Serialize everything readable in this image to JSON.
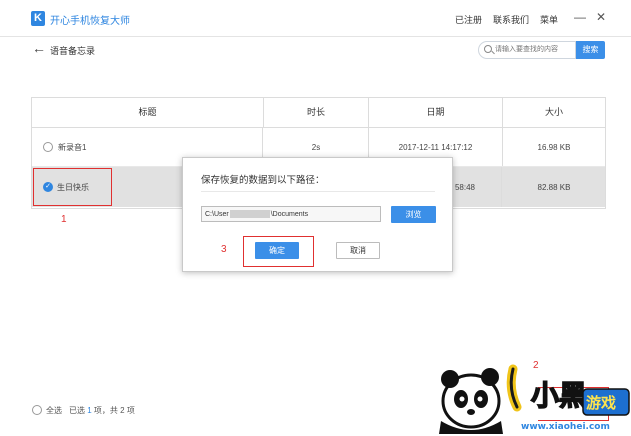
{
  "app": {
    "logo_letter": "K",
    "title": "开心手机恢复大师",
    "links": [
      "已注册",
      "联系我们",
      "菜单"
    ],
    "window_controls": [
      "—",
      "✕"
    ]
  },
  "nav": {
    "title": "语音备忘录",
    "search_placeholder": "请输入要查找的内容",
    "search_label": "搜索"
  },
  "table": {
    "headers": [
      "标题",
      "时长",
      "日期",
      "大小"
    ],
    "rows": [
      {
        "title": "新录音1",
        "duration": "2s",
        "date": "2017-12-11 14:17:12",
        "size": "16.98 KB",
        "checked": false
      },
      {
        "title": "生日快乐",
        "duration": "",
        "date": "58:48",
        "size": "82.88 KB",
        "checked": true
      }
    ]
  },
  "dialog": {
    "title": "保存恢复的数据到以下路径：",
    "path_prefix": "C:\\User",
    "path_suffix": "\\Documents",
    "browse_label": "浏览",
    "ok_label": "确定",
    "cancel_label": "取消"
  },
  "annotations": {
    "num1": "1",
    "num2": "2",
    "num3": "3"
  },
  "footer": {
    "select_all": "全选",
    "selected_prefix": "已选",
    "selected_count": "1",
    "selected_mid": "项，共",
    "total_count": "2",
    "selected_suffix": "项"
  },
  "watermark": {
    "brand": "小黑游戏",
    "url": "www.xiaohei.com"
  },
  "colors": {
    "accent": "#2f86e0",
    "annotation_red": "#e03030",
    "selected_row": "#e1e1e1"
  }
}
